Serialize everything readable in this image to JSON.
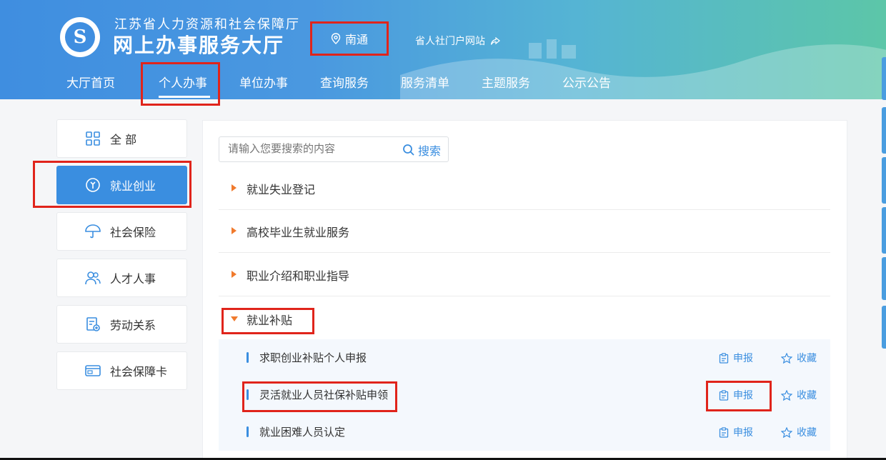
{
  "header": {
    "org_name": "江苏省人力资源和社会保障厅",
    "hall_name": "网上办事服务大厅",
    "city": "南通",
    "portal_link": "省人社门户网站",
    "logo_text": "S"
  },
  "nav": {
    "items": [
      "大厅首页",
      "个人办事",
      "单位办事",
      "查询服务",
      "服务清单",
      "主题服务",
      "公示公告"
    ],
    "active": "个人办事"
  },
  "sidebar": {
    "items": [
      {
        "label": "全 部",
        "icon": "grid-icon"
      },
      {
        "label": "就业创业",
        "icon": "employment-icon",
        "active": true
      },
      {
        "label": "社会保险",
        "icon": "umbrella-icon"
      },
      {
        "label": "人才人事",
        "icon": "people-icon"
      },
      {
        "label": "劳动关系",
        "icon": "document-add-icon"
      },
      {
        "label": "社会保障卡",
        "icon": "card-icon"
      }
    ]
  },
  "search": {
    "placeholder": "请输入您要搜索的内容",
    "button": "搜索"
  },
  "categories": [
    {
      "label": "就业失业登记",
      "expanded": false
    },
    {
      "label": "高校毕业生就业服务",
      "expanded": false
    },
    {
      "label": "职业介绍和职业指导",
      "expanded": false
    },
    {
      "label": "就业补贴",
      "expanded": true
    }
  ],
  "services": [
    {
      "label": "求职创业补贴个人申报",
      "apply": "申报",
      "favorite": "收藏"
    },
    {
      "label": "灵活就业人员社保补贴申领",
      "apply": "申报",
      "favorite": "收藏"
    },
    {
      "label": "就业困难人员认定",
      "apply": "申报",
      "favorite": "收藏"
    }
  ],
  "colors": {
    "primary": "#3a8ee0",
    "highlight_box": "#e0241b",
    "arrow": "#f07a2d"
  }
}
